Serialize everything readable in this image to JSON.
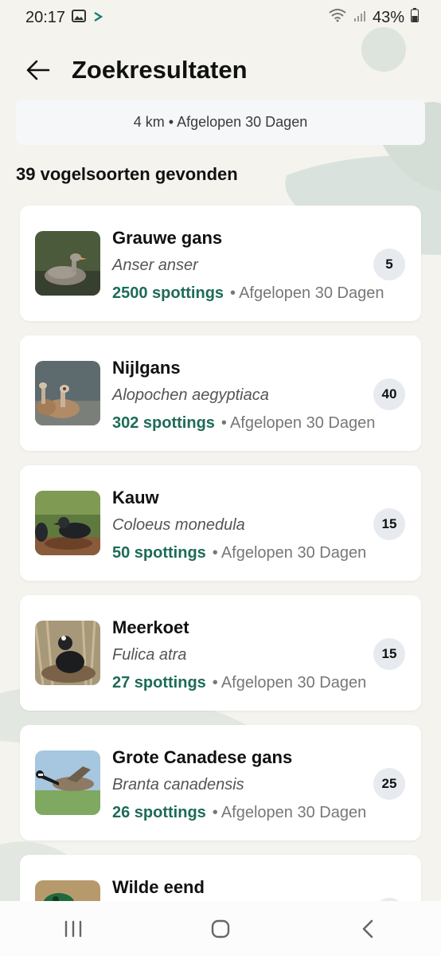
{
  "status_bar": {
    "time": "20:17",
    "battery": "43%",
    "icons": [
      "image-icon",
      "arrow-icon",
      "wifi-icon",
      "signal-icon",
      "battery-icon"
    ]
  },
  "header": {
    "title": "Zoekresultaten",
    "back_icon": "back-arrow-icon"
  },
  "filter": {
    "label": "4 km • Afgelopen 30 Dagen"
  },
  "results": {
    "count_label": "39 vogelsoorten gevonden"
  },
  "birds": [
    {
      "name": "Grauwe gans",
      "latin": "Anser anser",
      "spottings": "2500 spottings",
      "period": "Afgelopen 30 Dagen",
      "badge": "5"
    },
    {
      "name": "Nijlgans",
      "latin": "Alopochen aegyptiaca",
      "spottings": "302 spottings",
      "period": "Afgelopen 30 Dagen",
      "badge": "40"
    },
    {
      "name": "Kauw",
      "latin": "Coloeus monedula",
      "spottings": "50 spottings",
      "period": "Afgelopen 30 Dagen",
      "badge": "15"
    },
    {
      "name": "Meerkoet",
      "latin": "Fulica atra",
      "spottings": "27 spottings",
      "period": "Afgelopen 30 Dagen",
      "badge": "15"
    },
    {
      "name": "Grote Canadese gans",
      "latin": "Branta canadensis",
      "spottings": "26 spottings",
      "period": "Afgelopen 30 Dagen",
      "badge": "25"
    },
    {
      "name": "Wilde eend",
      "latin": "",
      "spottings": "",
      "period": "",
      "badge": ""
    }
  ],
  "nav": {
    "icons": [
      "recents-icon",
      "home-icon",
      "back-icon"
    ]
  },
  "colors": {
    "accent": "#1d6b58",
    "background": "#f4f3ee",
    "badge_bg": "#e7eaef"
  }
}
